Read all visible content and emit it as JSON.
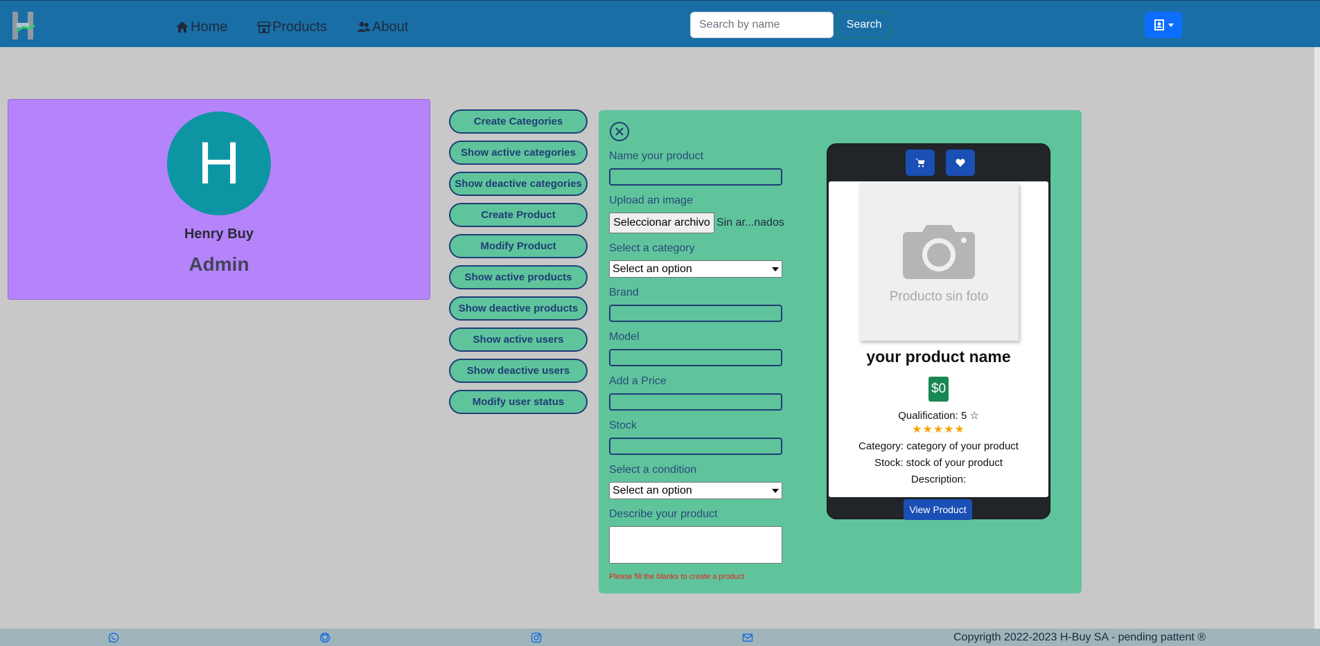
{
  "navbar": {
    "links": [
      {
        "label": "Home",
        "icon": "home-icon"
      },
      {
        "label": "Products",
        "icon": "store-icon"
      },
      {
        "label": "About",
        "icon": "users-icon"
      }
    ],
    "search_placeholder": "Search by name",
    "search_label": "Search",
    "user_icon": "contact-card-icon"
  },
  "profile": {
    "avatar_letter": "H",
    "name": "Henry Buy",
    "role": "Admin"
  },
  "actions": [
    "Create Categories",
    "Show active categories",
    "Show deactive categories",
    "Create Product",
    "Modify Product",
    "Show active products",
    "Show deactive products",
    "Show active users",
    "Show deactive users",
    "Modify user status"
  ],
  "form": {
    "name_label": "Name your product",
    "image_label": "Upload an image",
    "file_button": "Seleccionar archivo",
    "file_status": "Sin ar...nados",
    "category_label": "Select a category",
    "category_value": "Select an option",
    "brand_label": "Brand",
    "model_label": "Model",
    "price_label": "Add a Price",
    "stock_label": "Stock",
    "condition_label": "Select a condition",
    "condition_value": "Select an option",
    "description_label": "Describe your product",
    "error": "Please fill the blanks to create a product"
  },
  "preview": {
    "no_photo_text": "Producto sin foto",
    "title": "your product name",
    "price": "$0",
    "qualification": "Qualification: 5 ☆",
    "stars": "★★★★★",
    "category": "Category: category of your product",
    "stock": "Stock: stock of your product",
    "description": "Description:",
    "view_button": "View Product"
  },
  "footer": {
    "icons": [
      "whatsapp-icon",
      "github-icon",
      "instagram-icon",
      "mail-icon"
    ],
    "copyright": "Copyrigth 2022-2023 H-Buy SA - pending pattent ®"
  },
  "colors": {
    "navbar": "#1a6ea6",
    "background": "#c8c8c8",
    "profile_card": "#b584fa",
    "avatar": "#0e95a3",
    "panel": "#5fc49c",
    "primary": "#0d6efd",
    "price": "#198754"
  }
}
